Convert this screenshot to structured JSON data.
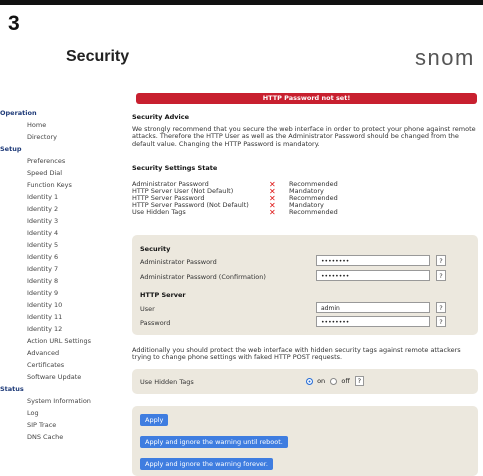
{
  "step_number": "3",
  "page_title": "Security",
  "brand": "snom",
  "sidebar": {
    "sections": [
      {
        "title": "Operation",
        "items": [
          "Home",
          "Directory"
        ]
      },
      {
        "title": "Setup",
        "items": [
          "Preferences",
          "Speed Dial",
          "Function Keys",
          "Identity 1",
          "Identity 2",
          "Identity 3",
          "Identity 4",
          "Identity 5",
          "Identity 6",
          "Identity 7",
          "Identity 8",
          "Identity 9",
          "Identity 10",
          "Identity 11",
          "Identity 12",
          "Action URL Settings",
          "Advanced",
          "Certificates",
          "Software Update"
        ]
      },
      {
        "title": "Status",
        "items": [
          "System Information",
          "Log",
          "SIP Trace",
          "DNS Cache"
        ]
      }
    ]
  },
  "banner": "HTTP Password not set!",
  "advice": {
    "title": "Security Advice",
    "text": "We strongly recommend that you secure the web interface in order to protect your phone against remote attacks. Therefore the HTTP User as well as the Administrator Password should be changed from the default value. Changing the HTTP Password is mandatory."
  },
  "state": {
    "title": "Security Settings State",
    "rows": [
      {
        "label": "Administrator Password",
        "mark": "✕",
        "value": "Recommended"
      },
      {
        "label": "HTTP Server User (Not Default)",
        "mark": "✕",
        "value": "Mandatory"
      },
      {
        "label": "HTTP Server Password",
        "mark": "✕",
        "value": "Recommended"
      },
      {
        "label": "HTTP Server Password (Not Default)",
        "mark": "✕",
        "value": "Mandatory"
      },
      {
        "label": "Use Hidden Tags",
        "mark": "✕",
        "value": "Recommended"
      }
    ]
  },
  "security_box": {
    "title": "Security",
    "admin_password_label": "Administrator Password",
    "admin_password_value": "••••••••",
    "admin_password_confirm_label": "Administrator Password (Confirmation)",
    "admin_password_confirm_value": "••••••••",
    "http_title": "HTTP Server",
    "user_label": "User",
    "user_value": "admin",
    "password_label": "Password",
    "password_value": "••••••••",
    "help": "?"
  },
  "hidden_tags": {
    "text": "Additionally you should protect the web interface with hidden security tags against remote attackers trying to change phone settings with faked HTTP POST requests.",
    "label": "Use Hidden Tags",
    "on_label": "on",
    "off_label": "off",
    "selected": "on",
    "help": "?"
  },
  "buttons": {
    "apply": "Apply",
    "apply_ignore_reboot": "Apply and ignore the warning until reboot.",
    "apply_ignore_forever": "Apply and ignore the warning forever."
  },
  "colors": {
    "banner": "#c8202f",
    "button": "#3f7de0",
    "box": "#ece8de",
    "nav_section": "#1e3a78",
    "cross": "#dd1111"
  }
}
